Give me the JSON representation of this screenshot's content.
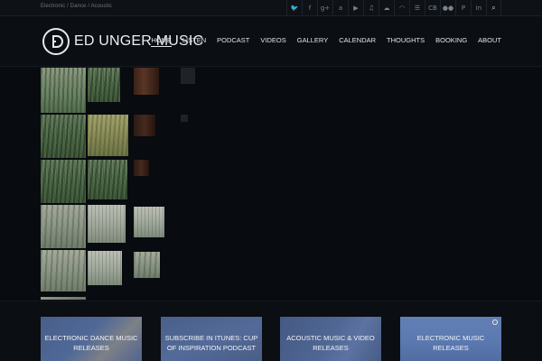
{
  "topbar": {
    "tagline": "Electronic / Dance / Acoustic",
    "social_icons": [
      {
        "name": "twitter-icon",
        "glyph": "🐦"
      },
      {
        "name": "facebook-icon",
        "glyph": "f"
      },
      {
        "name": "google-plus-icon",
        "glyph": "g+"
      },
      {
        "name": "amazon-icon",
        "glyph": "a"
      },
      {
        "name": "youtube-icon",
        "glyph": "▶"
      },
      {
        "name": "itunes-icon",
        "glyph": "♫"
      },
      {
        "name": "soundcloud-icon",
        "glyph": "☁"
      },
      {
        "name": "headphones-icon",
        "glyph": "◠"
      },
      {
        "name": "beatport-icon",
        "glyph": "☰"
      },
      {
        "name": "cdbaby-icon",
        "glyph": "CB"
      },
      {
        "name": "flickr-icon",
        "glyph": "●●"
      },
      {
        "name": "pinterest-icon",
        "glyph": "P"
      },
      {
        "name": "linkedin-icon",
        "glyph": "in"
      }
    ],
    "search_glyph": "⌕"
  },
  "header": {
    "logo_text": "ED UNGER MUSIC",
    "nav": [
      {
        "label": "HOME",
        "active": true
      },
      {
        "label": "LISTEN"
      },
      {
        "label": "PODCAST"
      },
      {
        "label": "VIDEOS"
      },
      {
        "label": "GALLERY"
      },
      {
        "label": "CALENDAR"
      },
      {
        "label": "THOUGHTS"
      },
      {
        "label": "BOOKING"
      },
      {
        "label": "ABOUT"
      }
    ]
  },
  "cards": [
    {
      "label": "ELECTRONIC DANCE MUSIC RELEASES"
    },
    {
      "label": "SUBSCRIBE IN ITUNES: CUP OF INSPIRATION PODCAST"
    },
    {
      "label": "ACOUSTIC MUSIC & VIDEO RELEASES"
    },
    {
      "label": "ELECTRONIC MUSIC RELEASES"
    }
  ],
  "colors": {
    "background": "#0b0e12",
    "card_overlay": "#5c7ab4",
    "nav_text": "#e1e4e8"
  }
}
